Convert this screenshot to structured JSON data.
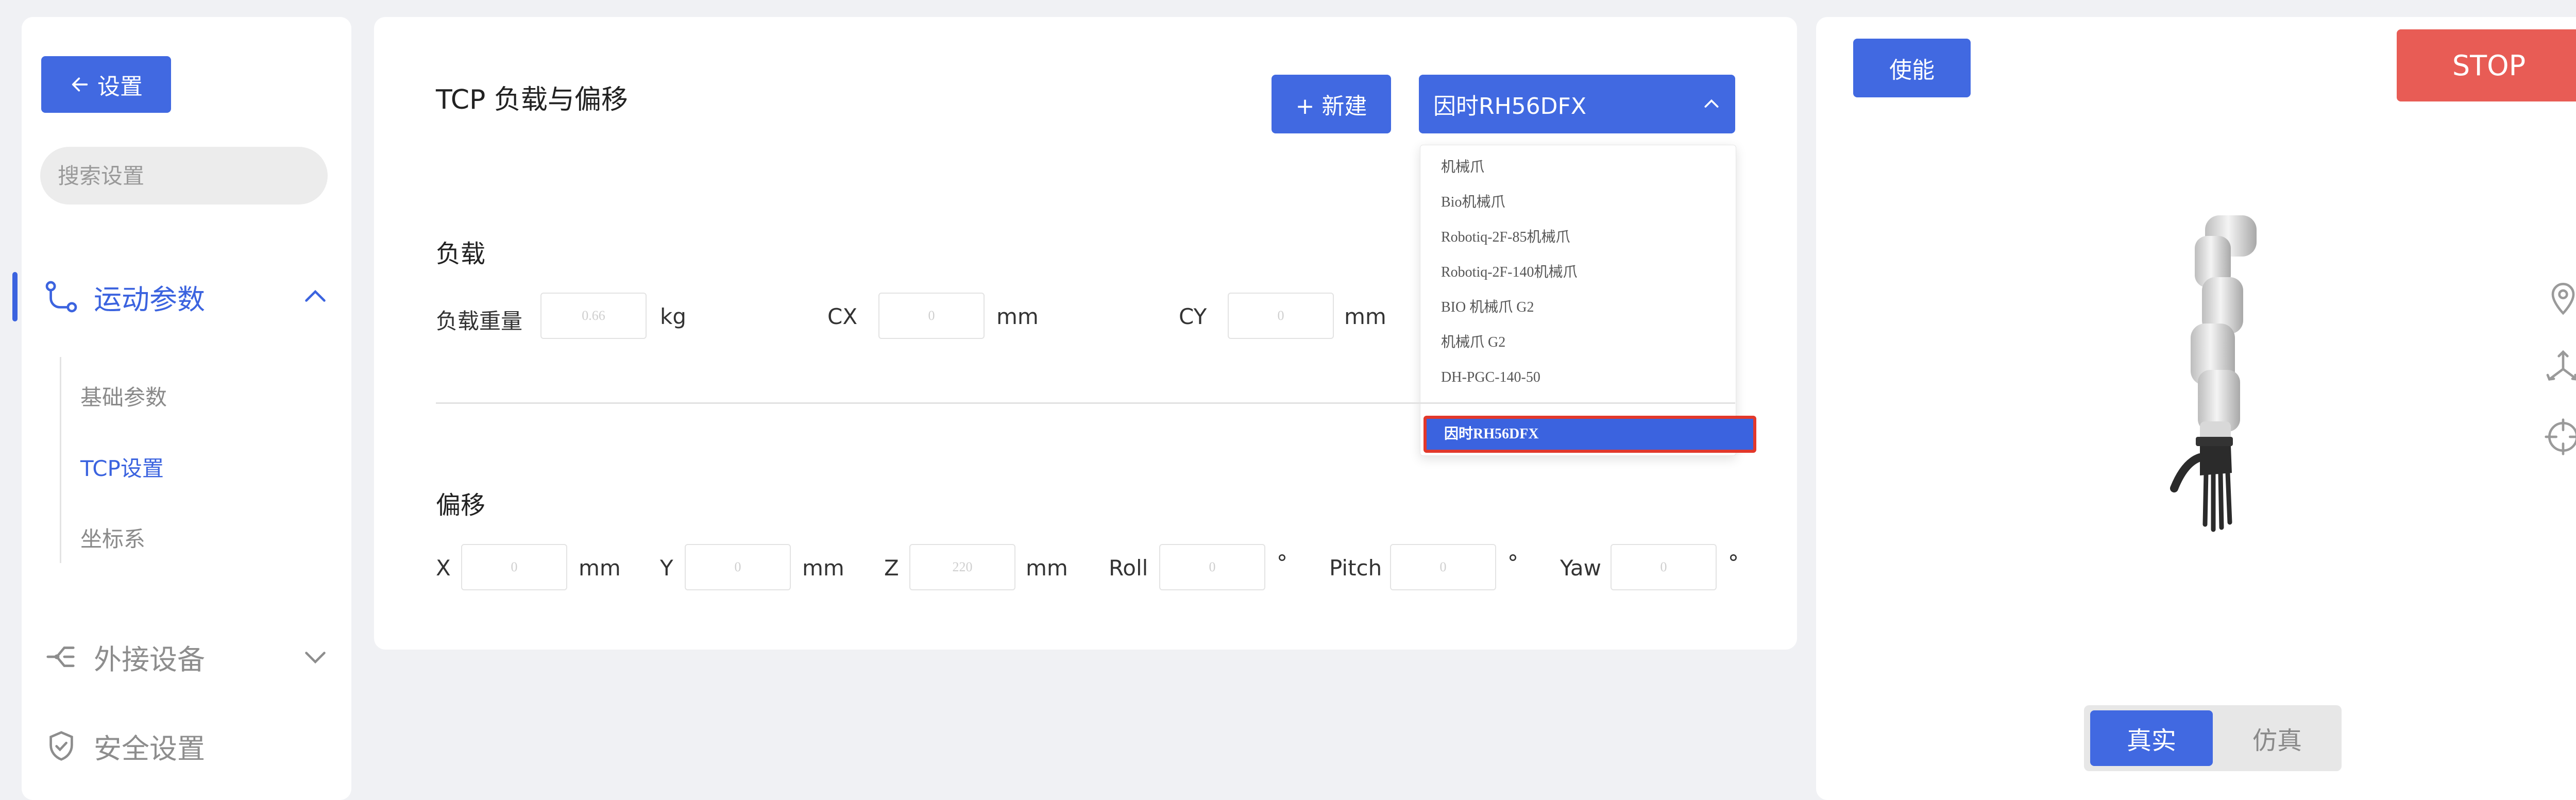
{
  "sidebar": {
    "back_label": "设置",
    "search_placeholder": "搜索设置",
    "motion_params": {
      "label": "运动参数",
      "items": [
        "基础参数",
        "TCP设置",
        "坐标系"
      ]
    },
    "external_devices": "外接设备",
    "safety_settings": "安全设置"
  },
  "main": {
    "title": "TCP 负载与偏移",
    "new_label": "+ 新建",
    "tool_select": {
      "selected": "因时RH56DFX",
      "options": [
        "机械爪",
        "Bio机械爪",
        "Robotiq-2F-85机械爪",
        "Robotiq-2F-140机械爪",
        "BIO 机械爪 G2",
        "机械爪 G2",
        "DH-PGC-140-50",
        "因时RH56DFX"
      ]
    },
    "load": {
      "title": "负载",
      "weight_label": "负载重量",
      "weight_value": "0.66",
      "weight_unit": "kg",
      "cx_label": "CX",
      "cx_value": "0",
      "cx_unit": "mm",
      "cy_label": "CY",
      "cy_value": "0",
      "cy_unit": "mm"
    },
    "offset": {
      "title": "偏移",
      "fields": [
        {
          "label": "X",
          "value": "0",
          "unit": "mm"
        },
        {
          "label": "Y",
          "value": "0",
          "unit": "mm"
        },
        {
          "label": "Z",
          "value": "220",
          "unit": "mm"
        },
        {
          "label": "Roll",
          "value": "0",
          "unit": "°"
        },
        {
          "label": "Pitch",
          "value": "0",
          "unit": "°"
        },
        {
          "label": "Yaw",
          "value": "0",
          "unit": "°"
        }
      ]
    }
  },
  "right": {
    "enable_label": "使能",
    "stop_label": "STOP",
    "mode_real": "真实",
    "mode_sim": "仿真",
    "icons": [
      "location-pin-icon",
      "axes-icon",
      "crosshair-icon"
    ]
  },
  "colors": {
    "accent": "#4169e1",
    "stop": "#e85c55",
    "highlight_border": "#e2382b"
  }
}
